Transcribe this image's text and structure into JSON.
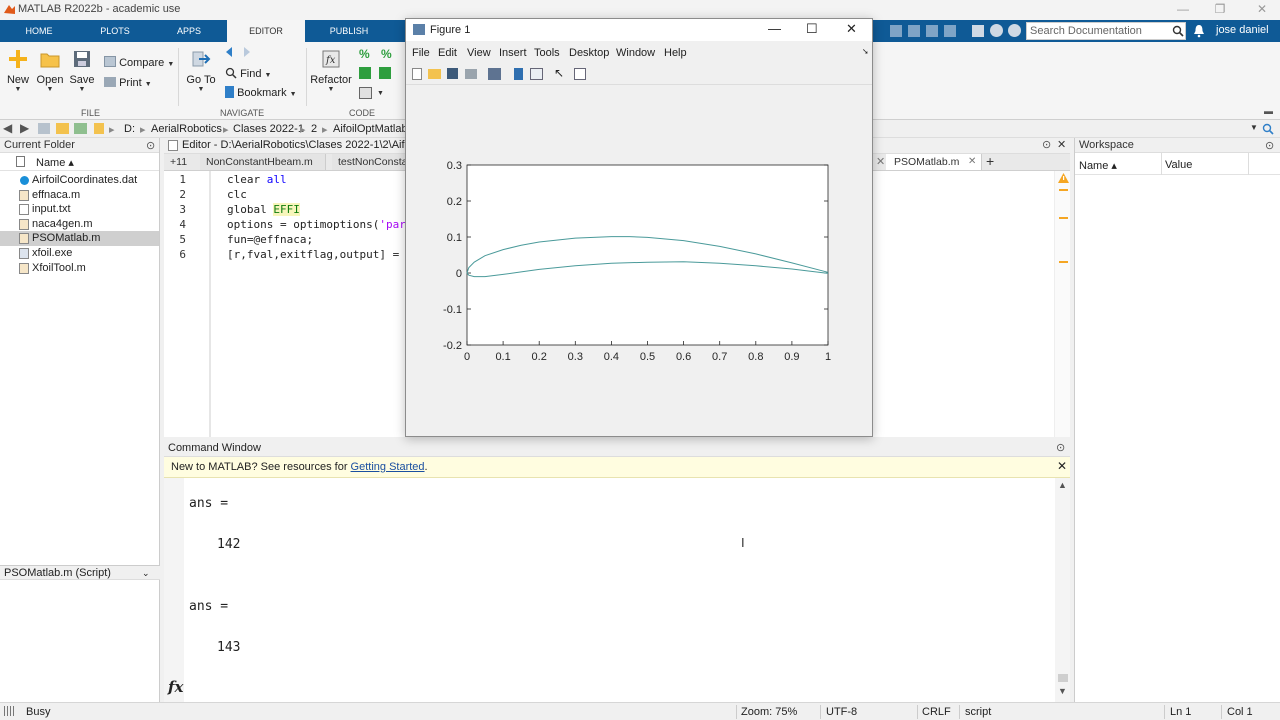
{
  "window": {
    "title": "MATLAB R2022b - academic use"
  },
  "tabs": [
    "HOME",
    "PLOTS",
    "APPS",
    "EDITOR",
    "PUBLISH"
  ],
  "search": {
    "placeholder": "Search Documentation"
  },
  "user": {
    "name": "jose daniel"
  },
  "ribbon": {
    "new": "New",
    "open": "Open",
    "save": "Save",
    "compare": "Compare",
    "print": "Print",
    "goto": "Go To",
    "find": "Find",
    "bookmark": "Bookmark",
    "refactor": "Refactor",
    "groups": {
      "file": "FILE",
      "navigate": "NAVIGATE",
      "code": "CODE"
    }
  },
  "address": {
    "drive": "D:",
    "crumbs": [
      "AerialRobotics",
      "Clases 2022-1",
      "2",
      "AifoilOptMatlab"
    ]
  },
  "current_folder": {
    "title": "Current Folder",
    "column": "Name ▴",
    "files": [
      "AirfoilCoordinates.dat",
      "effnaca.m",
      "input.txt",
      "naca4gen.m",
      "PSOMatlab.m",
      "xfoil.exe",
      "XfoilTool.m"
    ],
    "selected": "PSOMatlab.m",
    "details": "PSOMatlab.m  (Script)"
  },
  "editor": {
    "header": "Editor - D:\\AerialRobotics\\Clases 2022-1\\2\\AifoilO",
    "tab_count": "+11",
    "tabs": [
      "NonConstantHbeam.m",
      "testNonConsta",
      "PSOMatlab.m"
    ],
    "line_numbers": [
      "1",
      "2",
      "3",
      "4",
      "5",
      "6"
    ],
    "lines": {
      "l1a": "clear ",
      "l1b": "all",
      "l2": "clc",
      "l3a": "global ",
      "l3b": "EFFI",
      "l4a": "options = optimoptions(",
      "l4b": "'part",
      "l5": "fun=@effnaca;",
      "l6": "[r,fval,exitflag,output] = p"
    }
  },
  "figure": {
    "title": "Figure 1",
    "menus": [
      "File",
      "Edit",
      "View",
      "Insert",
      "Tools",
      "Desktop",
      "Window",
      "Help"
    ]
  },
  "chart_data": {
    "type": "line",
    "title": "",
    "xlabel": "",
    "ylabel": "",
    "xlim": [
      0,
      1
    ],
    "ylim": [
      -0.2,
      0.3
    ],
    "xticks": [
      "0",
      "0.1",
      "0.2",
      "0.3",
      "0.4",
      "0.5",
      "0.6",
      "0.7",
      "0.8",
      "0.9",
      "1"
    ],
    "yticks": [
      "-0.2",
      "-0.1",
      "0",
      "0.1",
      "0.2",
      "0.3"
    ],
    "grid": false,
    "color": "#4a9a9a",
    "series": [
      {
        "x": [
          0,
          0.005,
          0.02,
          0.05,
          0.1,
          0.15,
          0.2,
          0.3,
          0.4,
          0.45,
          0.5,
          0.6,
          0.7,
          0.8,
          0.9,
          1.0
        ],
        "y": [
          0,
          0.015,
          0.03,
          0.048,
          0.065,
          0.077,
          0.086,
          0.097,
          0.101,
          0.101,
          0.099,
          0.09,
          0.074,
          0.053,
          0.028,
          0.002
        ]
      },
      {
        "x": [
          0,
          0.005,
          0.02,
          0.05,
          0.1,
          0.15,
          0.2,
          0.3,
          0.4,
          0.5,
          0.6,
          0.7,
          0.8,
          0.9,
          1.0
        ],
        "y": [
          0,
          -0.006,
          -0.01,
          -0.01,
          -0.004,
          0.003,
          0.01,
          0.02,
          0.027,
          0.03,
          0.031,
          0.027,
          0.02,
          0.011,
          -0.001
        ]
      }
    ]
  },
  "command_window": {
    "title": "Command Window",
    "notice": "New to MATLAB? See resources for ",
    "link": "Getting Started",
    "notice_end": ".",
    "ans1_label": "ans =",
    "ans1": "142",
    "ans2_label": "ans =",
    "ans2": "143",
    "prompt": "fx"
  },
  "workspace": {
    "title": "Workspace",
    "col_name": "Name ▴",
    "col_value": "Value"
  },
  "status": {
    "state": "Busy",
    "zoom": "Zoom: 75%",
    "encoding": "UTF-8",
    "eol": "CRLF",
    "type": "script",
    "ln": "Ln  1",
    "col": "Col  1"
  }
}
